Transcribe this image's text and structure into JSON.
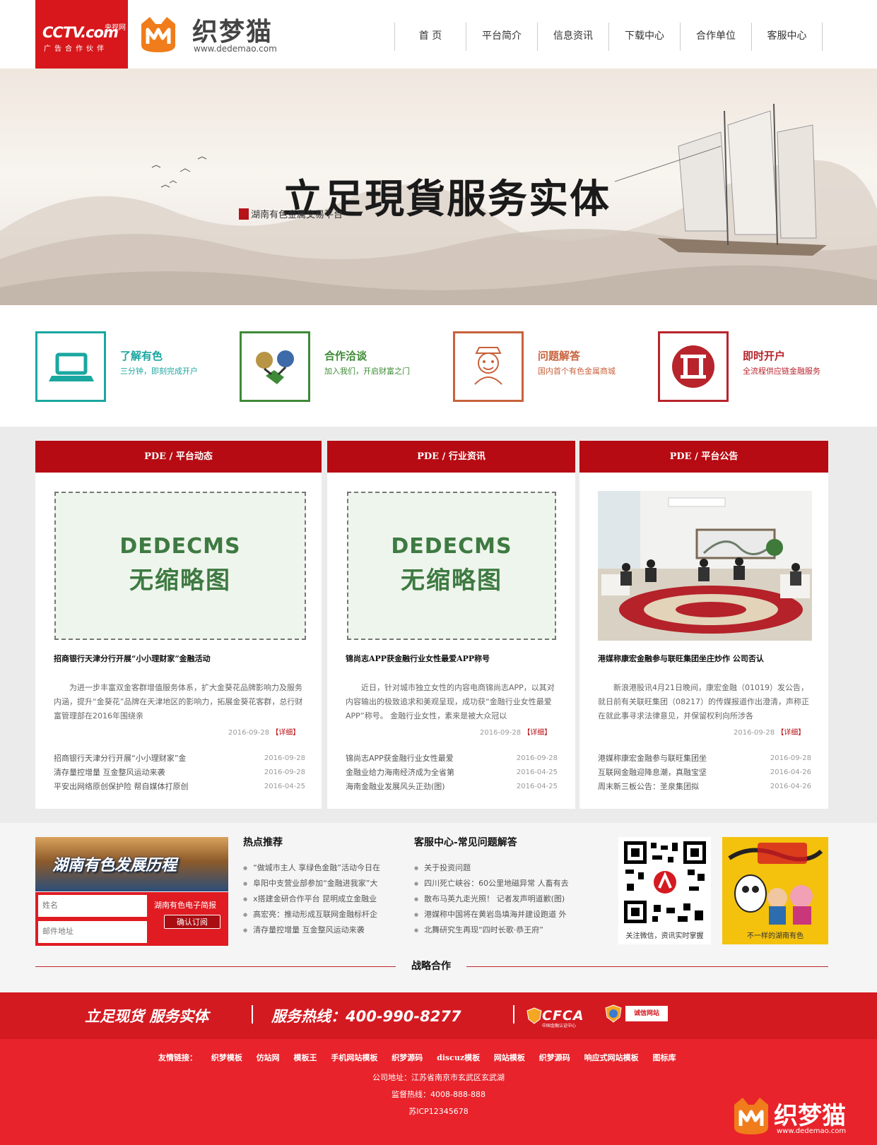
{
  "header": {
    "cctv": {
      "logo": "CCTV.com",
      "sub": "央视网",
      "partner": "广告合作伙伴"
    },
    "brand": {
      "name": "织梦猫",
      "url": "www.dedemao.com"
    },
    "nav": [
      "首  页",
      "平台简介",
      "信息资讯",
      "下载中心",
      "合作单位",
      "客服中心"
    ]
  },
  "banner": {
    "slogan": "立足現貨服务实体",
    "sub": "湖南有色金属交易平台"
  },
  "features": [
    {
      "title": "了解有色",
      "desc": "三分钟，即刻完成开户",
      "icon": "laptop-icon",
      "color": "#1aa7a0"
    },
    {
      "title": "合作洽谈",
      "desc": "加入我们，开启财富之门",
      "icon": "handshake-icon",
      "color": "#3e8a37"
    },
    {
      "title": "问题解答",
      "desc": "国内首个有色金属商城",
      "icon": "fortune-god-icon",
      "color": "#c8623c"
    },
    {
      "title": "即时开户",
      "desc": "全流程供应链金融服务",
      "icon": "open-account-icon",
      "color": "#b8242c"
    }
  ],
  "panels": [
    {
      "head": "PDE  /  平台动态",
      "thumb": {
        "line1": "DEDECMS",
        "line2": "无缩略图"
      },
      "title": "招商银行天津分行开展“小小理财家”金融活动",
      "summary": "为进一步丰富双金客群增值服务体系，扩大金葵花品牌影响力及服务内涵，提升“金葵花”品牌在天津地区的影响力，拓展金葵花客群，总行财富管理部在2016年围绕亲",
      "date": "2016-09-28",
      "more": "【详细】",
      "list": [
        {
          "t": "招商银行天津分行开展“小小理财家”金",
          "d": "2016-09-28"
        },
        {
          "t": "清存量控增量 互金整风运动来袭",
          "d": "2016-09-28"
        },
        {
          "t": "平安出网络原创保护险 帮自媒体打原创",
          "d": "2016-04-25"
        }
      ]
    },
    {
      "head": "PDE  /  行业资讯",
      "thumb": {
        "line1": "DEDECMS",
        "line2": "无缩略图"
      },
      "title": "锦尚志APP获金融行业女性最爱APP称号",
      "summary": "近日，针对城市独立女性的内容电商锦尚志APP，以其对内容输出的极致追求和美观呈现，成功获“金融行业女性最爱APP”称号。 金融行业女性，素来是被大众冠以",
      "date": "2016-09-28",
      "more": "【详细】",
      "list": [
        {
          "t": "锦尚志APP获金融行业女性最爱",
          "d": "2016-09-28"
        },
        {
          "t": "金融业给力海南经济成为全省第",
          "d": "2016-04-25"
        },
        {
          "t": "海南金融业发展风头正劲(图)",
          "d": "2016-04-25"
        }
      ]
    },
    {
      "head": "PDE  /  平台公告",
      "title": "港媒称康宏金融参与联旺集团坐庄炒作 公司否认",
      "summary": "新浪港股讯4月21日晚间，康宏金融（01019）发公告，就日前有关联旺集团（08217）的传媒报道作出澄清，声称正在就此事寻求法律意见，并保留权利向所涉各",
      "date": "2016-09-28",
      "more": "【详细】",
      "list": [
        {
          "t": "港媒称康宏金融参与联旺集团坐",
          "d": "2016-09-28"
        },
        {
          "t": "互联网金融迎降息潮，真融宝坚",
          "d": "2016-04-26"
        },
        {
          "t": "周末新三板公告：圣泉集团拟",
          "d": "2016-04-26"
        }
      ]
    }
  ],
  "lower": {
    "history": "湖南有色发展历程",
    "subscribe": {
      "name_placeholder": "姓名",
      "email_placeholder": "邮件地址",
      "label": "湖南有色电子简报",
      "button": "确认订阅"
    },
    "hot": {
      "title": "热点推荐",
      "items": [
        "“做城市主人 享绿色金融”活动今日在",
        "阜阳中支营业部参加“金融进我家”大",
        "x搭建金研合作平台 昆明成立金融业",
        "高宏亮：推动形成互联网金融标杆企",
        "清存量控增量 互金整风运动来袭"
      ]
    },
    "faq": {
      "title": "客服中心-常见问题解答",
      "items": [
        "关于投资问题",
        "四川死亡峡谷：60公里地磁异常 人畜有去",
        "散布马英九走光照！ 记者发声明道歉(图)",
        "港媒称中国将在黄岩岛填海并建设跑道 外",
        "北舞研究生再现“四时长歌·恭王府”"
      ]
    },
    "qr_caption": "关注微信，资讯实时掌握",
    "cartoon_caption": "不一样的湖南有色",
    "strategic": "战略合作"
  },
  "footer": {
    "slogan": "立足现货 服务实体",
    "hotline": "服务热线：400-990-8277",
    "cfca": "CFCA",
    "cfca_sub": "中国金融认证中心",
    "credit": "诚信网站",
    "friend_label": "友情链接：",
    "links": [
      "织梦模板",
      "仿站网",
      "模板王",
      "手机网站模板",
      "织梦源码",
      "discuz模板",
      "网站模板",
      "织梦源码",
      "响应式网站模板",
      "图标库"
    ],
    "address": "公司地址：江苏省南京市玄武区玄武湖",
    "supervise": "监督热线：4008-888-888",
    "icp": "苏ICP12345678",
    "corner_brand": "织梦猫",
    "corner_url": "www.dedemao.com"
  },
  "colors": {
    "brand_red": "#d41a21",
    "panel_red": "#b60b12",
    "teal": "#1aa7a0",
    "green": "#3e8a37",
    "orange": "#c8623c",
    "crimson": "#b8242c"
  }
}
